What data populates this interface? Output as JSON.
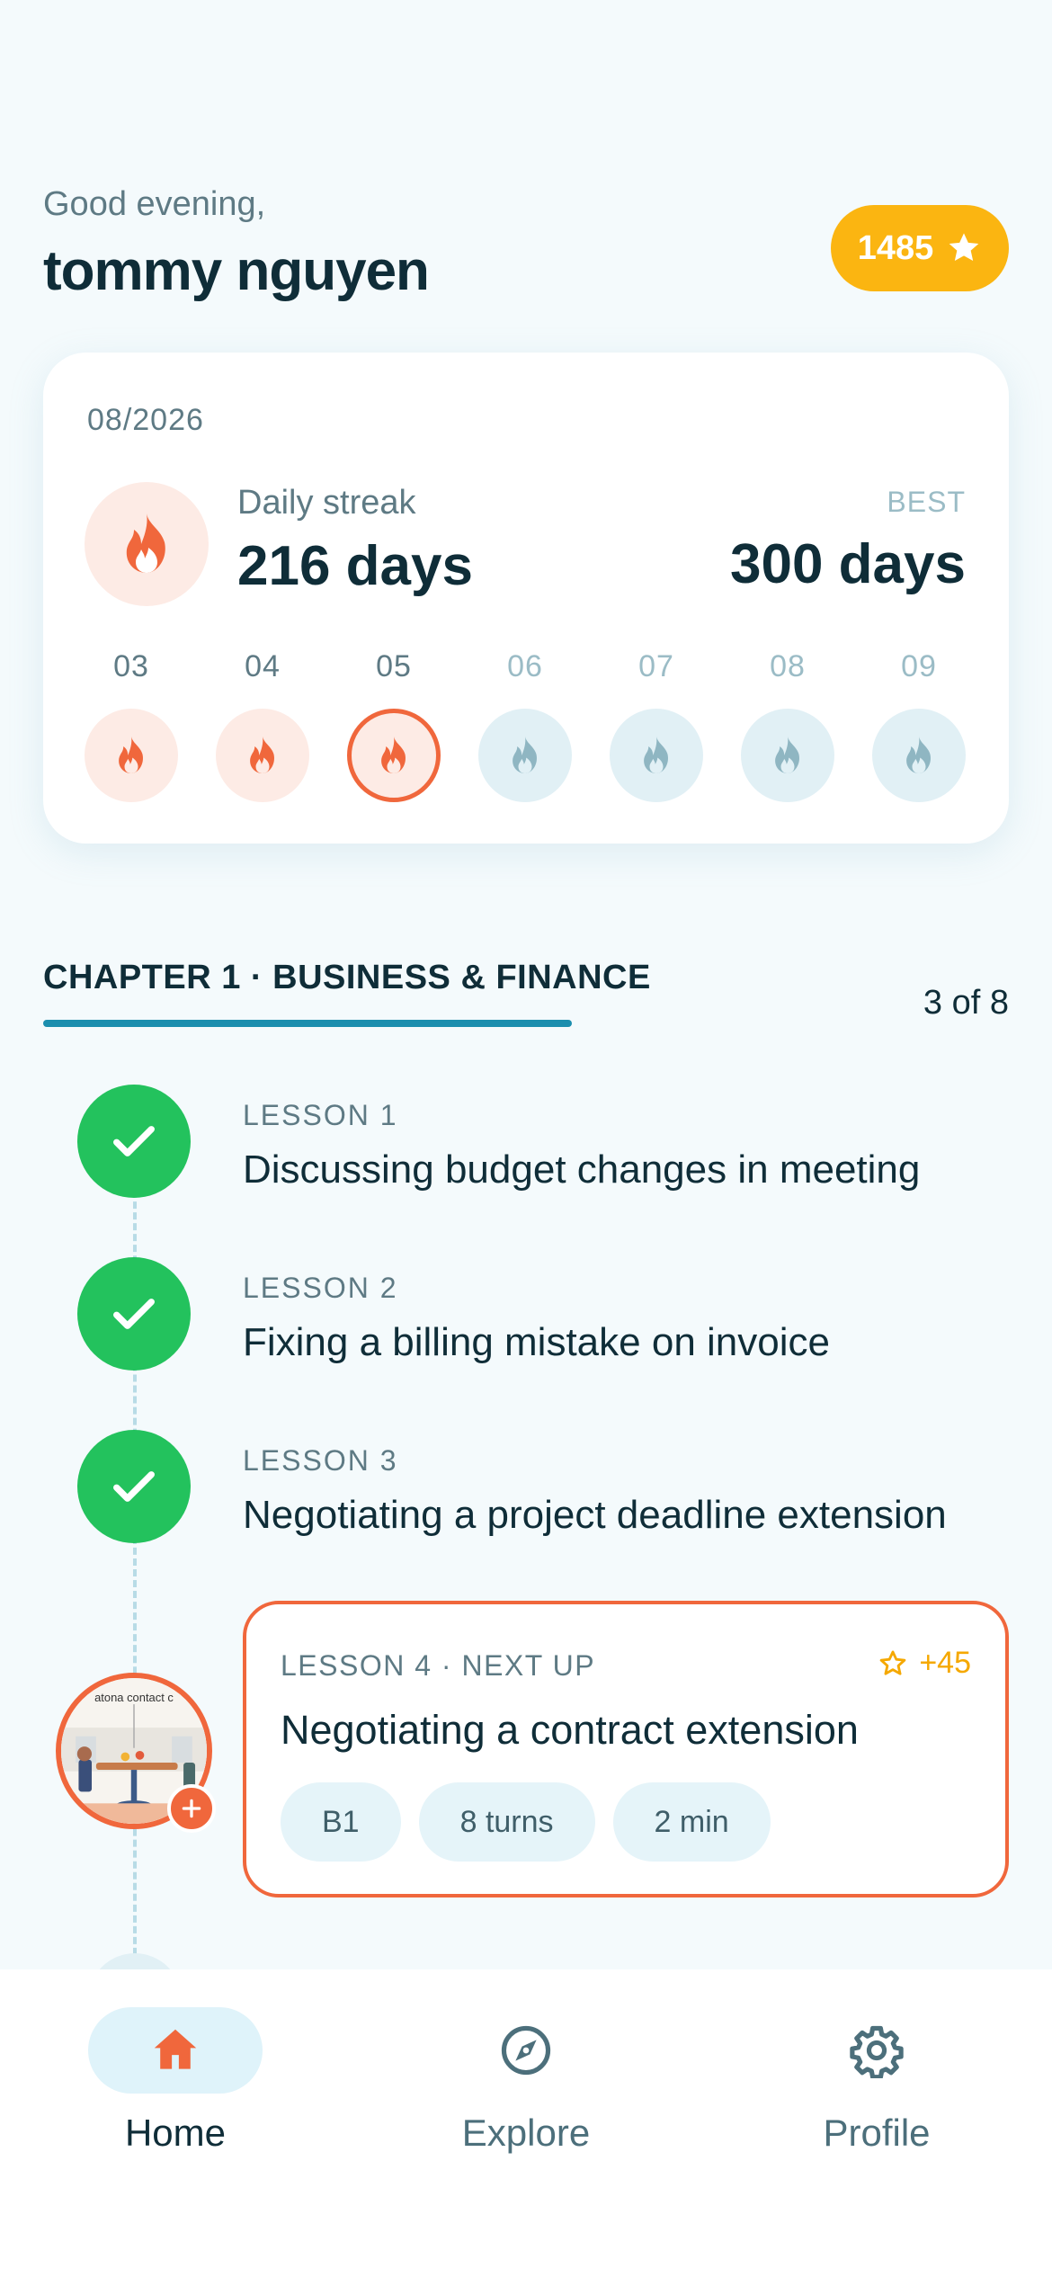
{
  "header": {
    "greeting": "Good evening,",
    "username": "tommy nguyen",
    "points": "1485"
  },
  "streak": {
    "month": "08/2026",
    "label": "Daily streak",
    "current": "216 days",
    "best_label": "BEST",
    "best": "300 days",
    "days": [
      {
        "num": "03",
        "state": "done"
      },
      {
        "num": "04",
        "state": "done"
      },
      {
        "num": "05",
        "state": "today"
      },
      {
        "num": "06",
        "state": "future"
      },
      {
        "num": "07",
        "state": "future"
      },
      {
        "num": "08",
        "state": "future"
      },
      {
        "num": "09",
        "state": "future"
      }
    ]
  },
  "chapter": {
    "title": "CHAPTER 1 · BUSINESS & FINANCE",
    "count": "3 of 8",
    "progress": 0.375
  },
  "lessons": [
    {
      "kicker": "LESSON 1",
      "title": "Discussing budget changes in meeting",
      "status": "completed"
    },
    {
      "kicker": "LESSON 2",
      "title": "Fixing a billing mistake on invoice",
      "status": "completed"
    },
    {
      "kicker": "LESSON 3",
      "title": "Negotiating a project deadline extension",
      "status": "completed"
    }
  ],
  "next_up": {
    "kicker": "LESSON 4 · NEXT UP",
    "xp": "+45",
    "title": "Negotiating a contract extension",
    "chips": [
      "B1",
      "8 turns",
      "2 min"
    ],
    "thumb_text": "atona contact c"
  },
  "nav": [
    {
      "label": "Home",
      "icon": "home-icon",
      "active": true
    },
    {
      "label": "Explore",
      "icon": "compass-icon",
      "active": false
    },
    {
      "label": "Profile",
      "icon": "gear-icon",
      "active": false
    }
  ],
  "colors": {
    "accent": "#f0673c",
    "gold": "#fbb511",
    "success": "#23c25d",
    "progress": "#1b8eae",
    "text_dark": "#0f2d38",
    "text_muted": "#5e7a84"
  }
}
